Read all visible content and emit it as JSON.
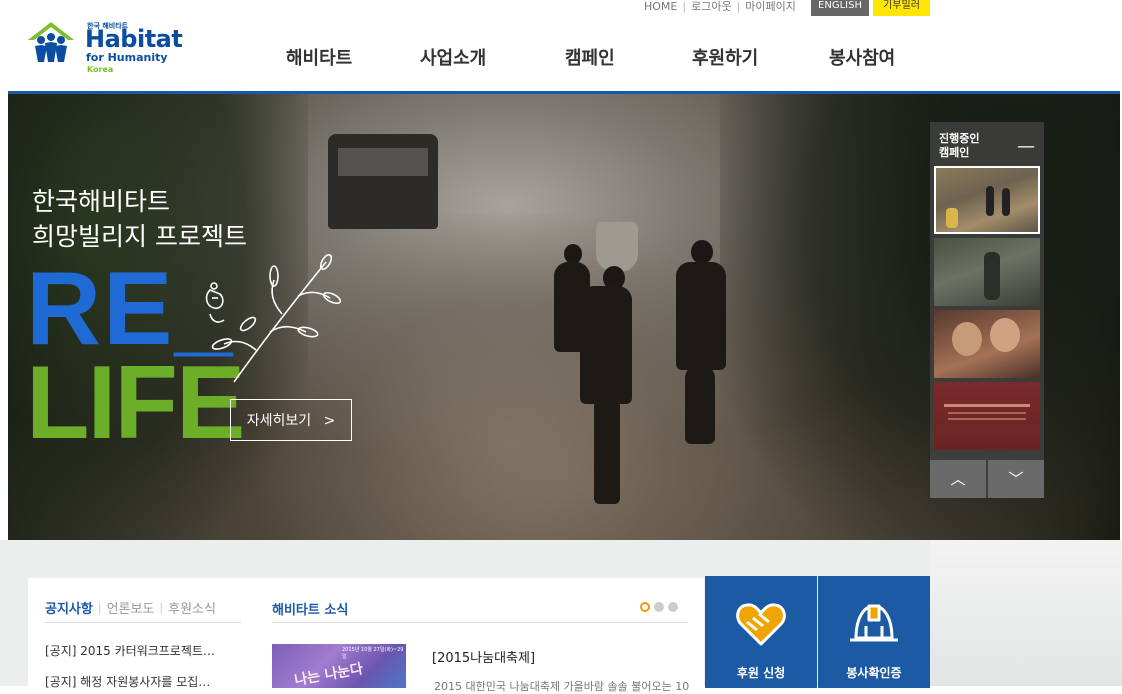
{
  "header": {
    "logo": {
      "small": "한국 해비타트",
      "main": "Habitat",
      "sub": "for Humanity",
      "country": "Korea"
    },
    "util_links": [
      "HOME",
      "로그아웃",
      "마이페이지"
    ],
    "english_label": "ENGLISH",
    "yellow_label": "기부밀러",
    "nav": [
      "해비타트",
      "사업소개",
      "캠페인",
      "후원하기",
      "봉사참여"
    ]
  },
  "hero": {
    "title_line1": "한국해비타트",
    "title_line2": "희망빌리지 프로젝트",
    "brand_re": "RE_",
    "brand_life": "LIFE",
    "cta_label": "자세히보기",
    "cta_arrow": ">",
    "campaign_panel": {
      "title_line1": "진행중인",
      "title_line2": "캠페인",
      "collapse_symbol": "—",
      "up_arrow": "︿",
      "down_arrow": "﹀"
    }
  },
  "notice": {
    "tabs": [
      "공지사항",
      "언론보도",
      "후원소식"
    ],
    "items": [
      "[공지] 2015 카터워크프로젝트…",
      "[공지] 해정 자원봉사자를 모집…"
    ]
  },
  "news": {
    "title": "해비타트 소식",
    "image_text": "나는 나눈다",
    "image_small": "2015년 10월 27일(화)~29일",
    "headline": "[2015나눔대축제]",
    "desc": "2015 대한민국 나눔대축제 가을바람 솔솔 불어오는 10"
  },
  "quick_links": [
    {
      "label": "후원 신청",
      "icon": "handshake-heart-icon"
    },
    {
      "label": "봉사확인증",
      "icon": "hardhat-icon"
    }
  ],
  "colors": {
    "brand_blue": "#1a58a8",
    "re_blue": "#1f6ad4",
    "life_green": "#6cae27",
    "accent_orange": "#f39a00",
    "quick_bg": "#1c5aa3"
  }
}
